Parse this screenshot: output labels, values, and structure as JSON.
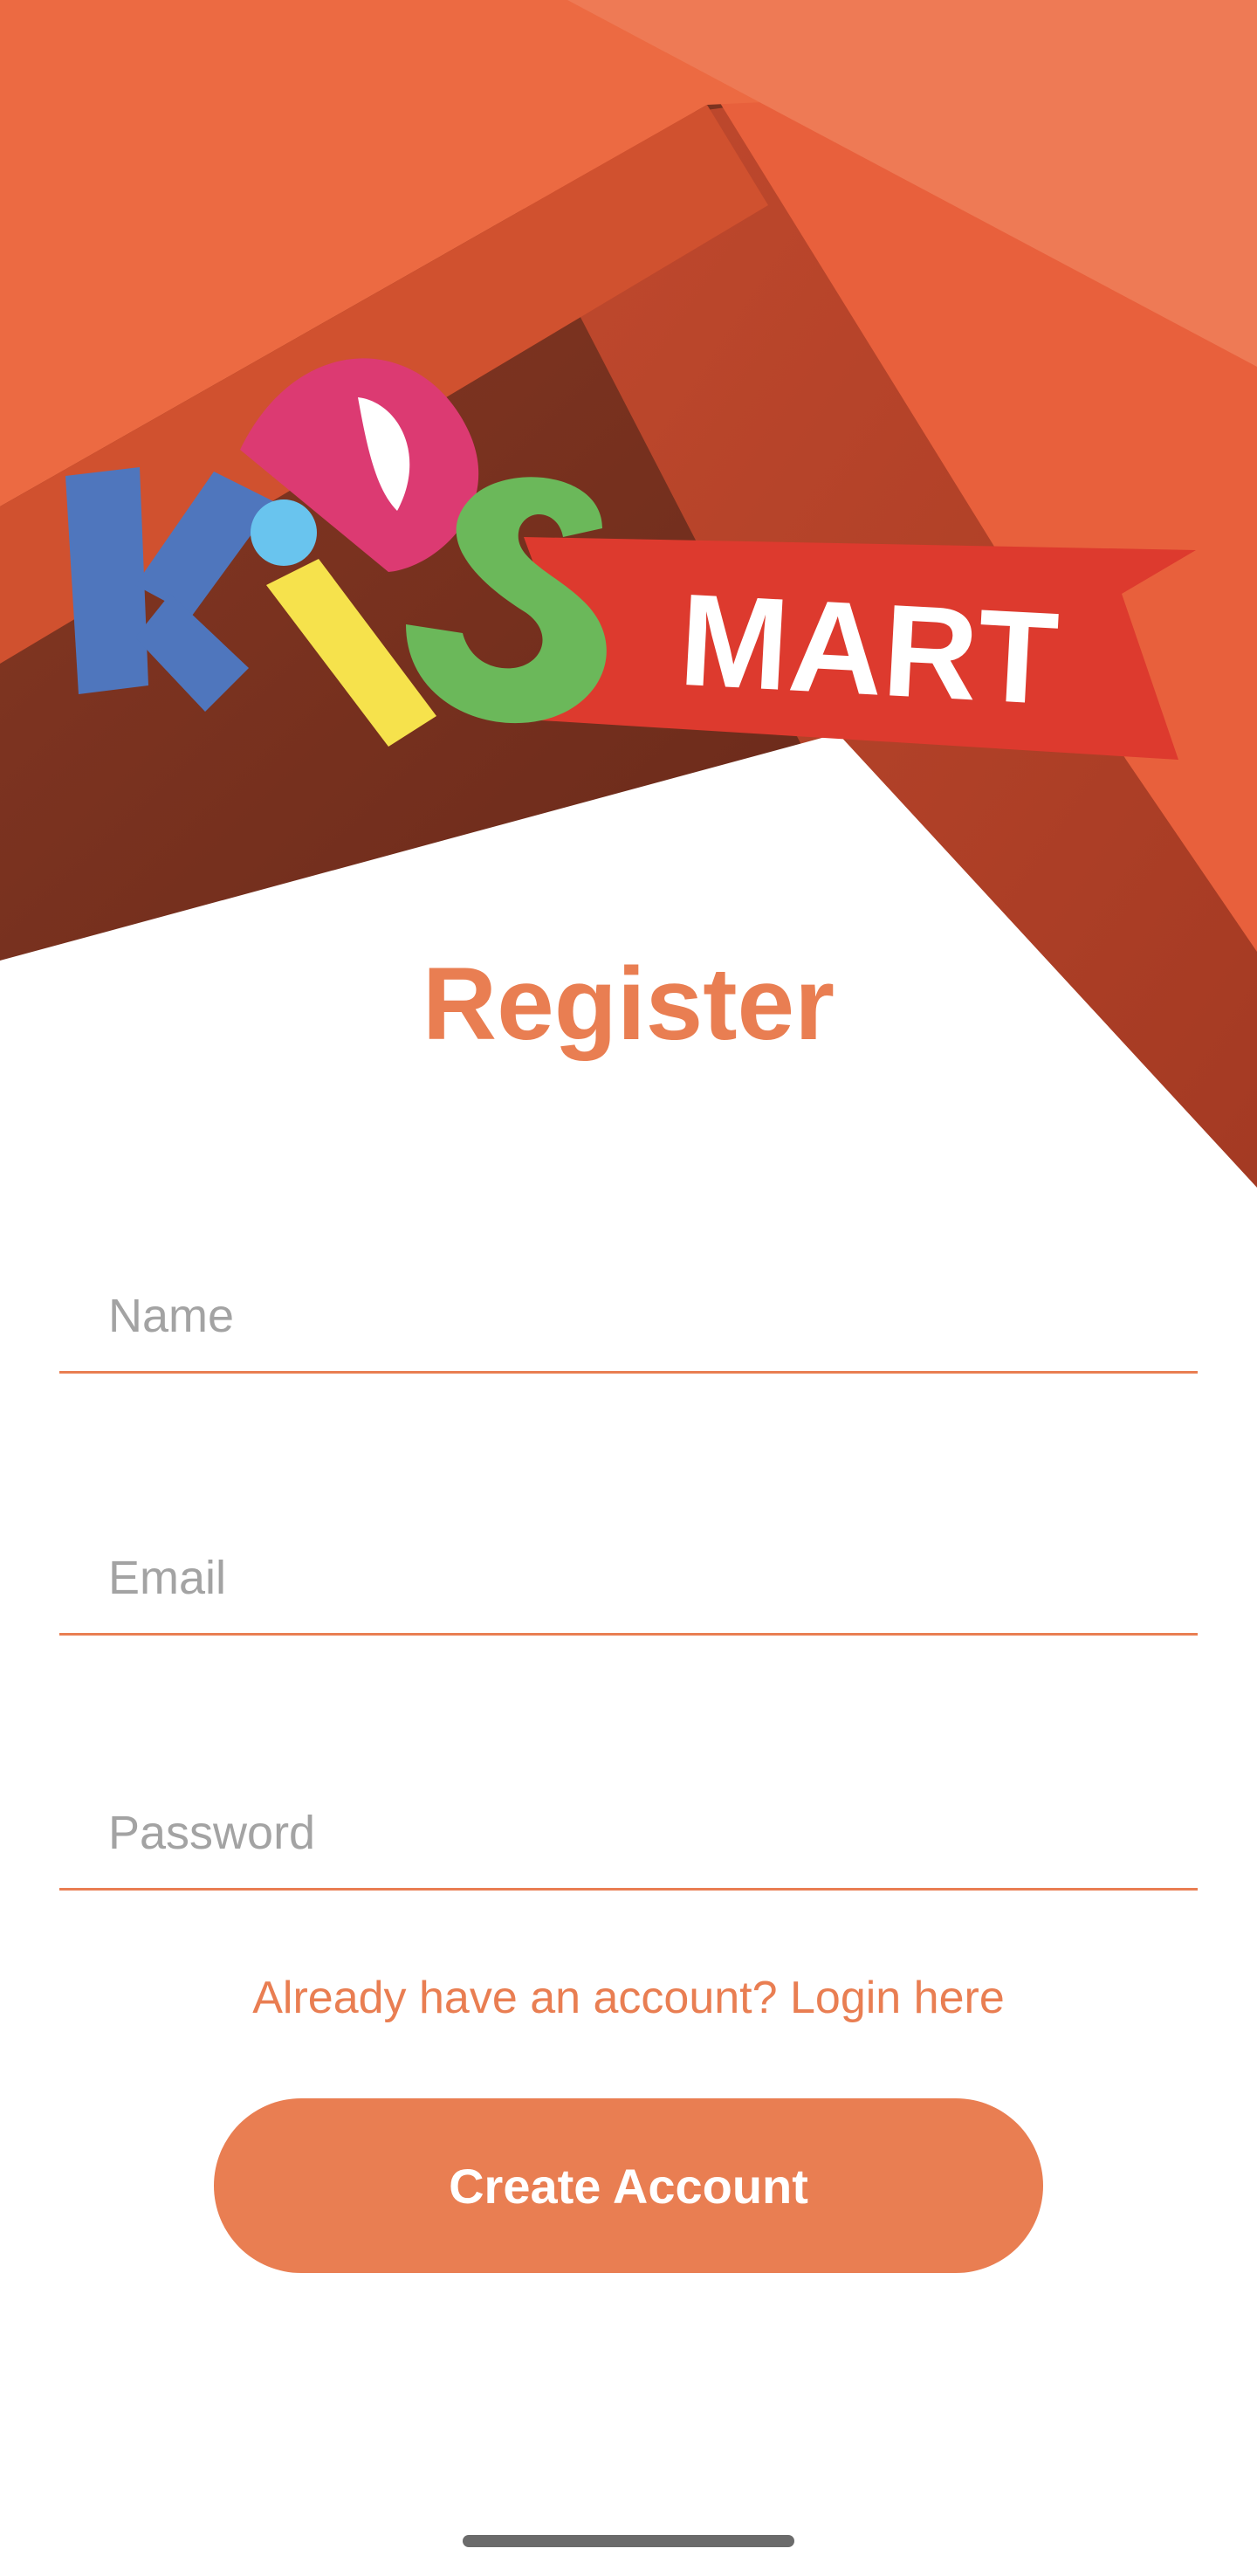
{
  "header": {
    "logo_word_kids": "KIDS",
    "logo_word_mart": "MART"
  },
  "form": {
    "title": "Register",
    "name_placeholder": "Name",
    "name_value": "",
    "email_placeholder": "Email",
    "email_value": "",
    "password_placeholder": "Password",
    "password_value": "",
    "login_link": "Already have an account? Login here",
    "create_button": "Create Account"
  },
  "colors": {
    "accent": "#e97e52",
    "header_orange": "#ec6a42",
    "header_dark": "#7a3322",
    "banner_red": "#dd3a2e",
    "letter_blue": "#4f76bd",
    "letter_pink": "#dc3a72",
    "letter_yellow": "#f6e24c",
    "letter_green": "#6bb85a",
    "dot_cyan": "#69c4ee"
  }
}
